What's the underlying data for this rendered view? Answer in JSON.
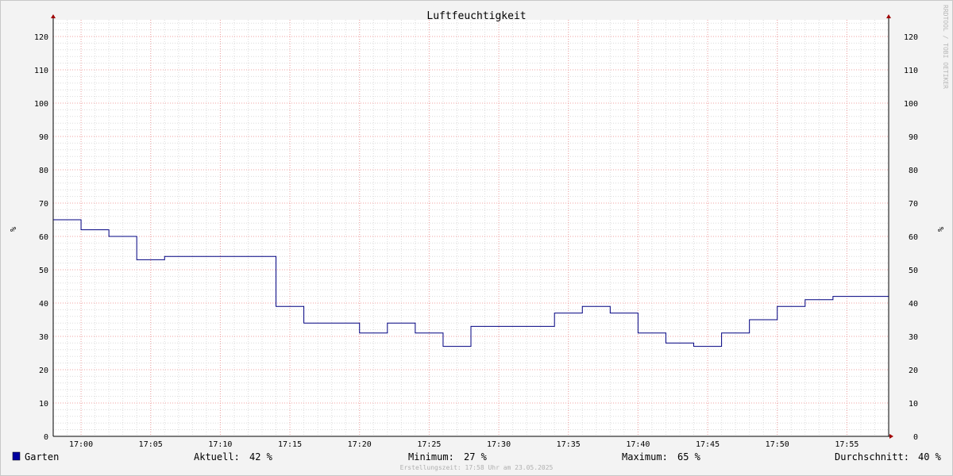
{
  "chart_data": {
    "type": "line",
    "step": true,
    "title": "Luftfeuchtigkeit",
    "ylabel": "%",
    "ylim": [
      0,
      125
    ],
    "yticks": [
      0,
      10,
      20,
      30,
      40,
      50,
      60,
      70,
      80,
      90,
      100,
      110,
      120
    ],
    "xlim": [
      "16:58",
      "17:58"
    ],
    "xticks": [
      "17:00",
      "17:05",
      "17:10",
      "17:15",
      "17:20",
      "17:25",
      "17:30",
      "17:35",
      "17:40",
      "17:45",
      "17:50",
      "17:55"
    ],
    "grid": true,
    "series": [
      {
        "name": "Garten",
        "color": "#000080",
        "points": [
          {
            "x": "16:58",
            "y": 65
          },
          {
            "x": "17:00",
            "y": 62
          },
          {
            "x": "17:02",
            "y": 60
          },
          {
            "x": "17:04",
            "y": 53
          },
          {
            "x": "17:06",
            "y": 54
          },
          {
            "x": "17:14",
            "y": 39
          },
          {
            "x": "17:16",
            "y": 34
          },
          {
            "x": "17:20",
            "y": 31
          },
          {
            "x": "17:22",
            "y": 34
          },
          {
            "x": "17:24",
            "y": 31
          },
          {
            "x": "17:26",
            "y": 27
          },
          {
            "x": "17:28",
            "y": 33
          },
          {
            "x": "17:30",
            "y": 33
          },
          {
            "x": "17:34",
            "y": 37
          },
          {
            "x": "17:36",
            "y": 39
          },
          {
            "x": "17:38",
            "y": 37
          },
          {
            "x": "17:40",
            "y": 31
          },
          {
            "x": "17:42",
            "y": 28
          },
          {
            "x": "17:44",
            "y": 27
          },
          {
            "x": "17:46",
            "y": 31
          },
          {
            "x": "17:48",
            "y": 35
          },
          {
            "x": "17:50",
            "y": 39
          },
          {
            "x": "17:52",
            "y": 41
          },
          {
            "x": "17:54",
            "y": 42
          },
          {
            "x": "17:58",
            "y": 42
          }
        ]
      }
    ]
  },
  "legend": {
    "series_name": "Garten",
    "current_label": "Aktuell:",
    "current_value": "42 %",
    "min_label": "Minimum:",
    "min_value": "27 %",
    "max_label": "Maximum:",
    "max_value": "65 %",
    "avg_label": "Durchschnitt:",
    "avg_value": "40 %"
  },
  "footer": "Erstellungszeit: 17:58 Uhr am 23.05.2025",
  "watermark": "RRDTOOL / TOBI OETIKER"
}
